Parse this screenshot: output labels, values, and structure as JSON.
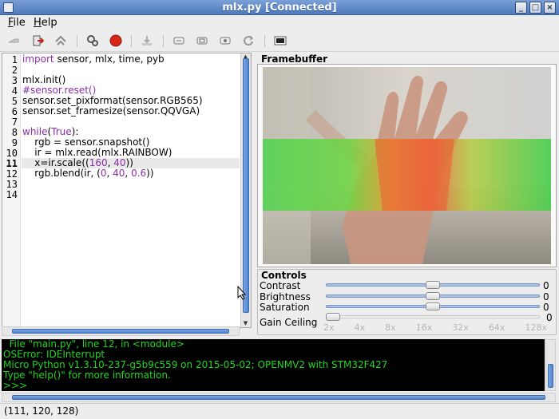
{
  "window": {
    "title": "mlx.py [Connected]"
  },
  "window_controls": [
    "_",
    "□",
    "×"
  ],
  "menu": {
    "file": "File",
    "file_mnemonic": "F",
    "file_rest": "ile",
    "help_mnemonic": "H",
    "help_rest": "elp"
  },
  "toolbar": {
    "icons": [
      "connect-icon",
      "disconnect-icon",
      "upgrade-icon",
      "run-icon",
      "stop-icon",
      "save-icon",
      "button-icon-1",
      "button-icon-2",
      "button-icon-3",
      "reset-icon",
      "video-icon"
    ]
  },
  "editor": {
    "line_numbers": [
      "1",
      "2",
      "3",
      "4",
      "5",
      "6",
      "7",
      "8",
      "9",
      "10",
      "11",
      "12",
      "13",
      "14"
    ],
    "current_line": "11",
    "lines": [
      "import sensor, mlx, time, pyb",
      "",
      "mlx.init()",
      "#sensor.reset()",
      "sensor.set_pixformat(sensor.RGB565)",
      "sensor.set_framesize(sensor.QQVGA)",
      "",
      "while(True):",
      "    rgb = sensor.snapshot()",
      "    ir = mlx.read(mlx.RAINBOW)",
      "    x=ir.scale((160, 40))",
      "    rgb.blend(ir, (0, 40, 0.6))",
      "",
      ""
    ]
  },
  "framebuffer": {
    "label": "Framebuffer"
  },
  "controls": {
    "title": "Controls",
    "sliders": [
      {
        "label": "Contrast",
        "value": "0",
        "position": 0.5
      },
      {
        "label": "Brightness",
        "value": "0",
        "position": 0.5
      },
      {
        "label": "Saturation",
        "value": "0",
        "position": 0.5
      }
    ],
    "gain": {
      "label": "Gain Ceiling",
      "value": "0",
      "position": 0.0,
      "ticks": [
        "2x",
        "4x",
        "8x",
        "16x",
        "32x",
        "64x",
        "128x"
      ]
    }
  },
  "terminal": {
    "lines": [
      "  File \"main.py\", line 12, in <module>",
      "OSError: IDEInterrupt",
      "Micro Python v1.3.10-237-g5b9c559 on 2015-05-02; OPENMV2 with STM32F427",
      "Type \"help()\" for more information.",
      ">>> "
    ]
  },
  "status": {
    "text": "(111, 120, 128)"
  }
}
